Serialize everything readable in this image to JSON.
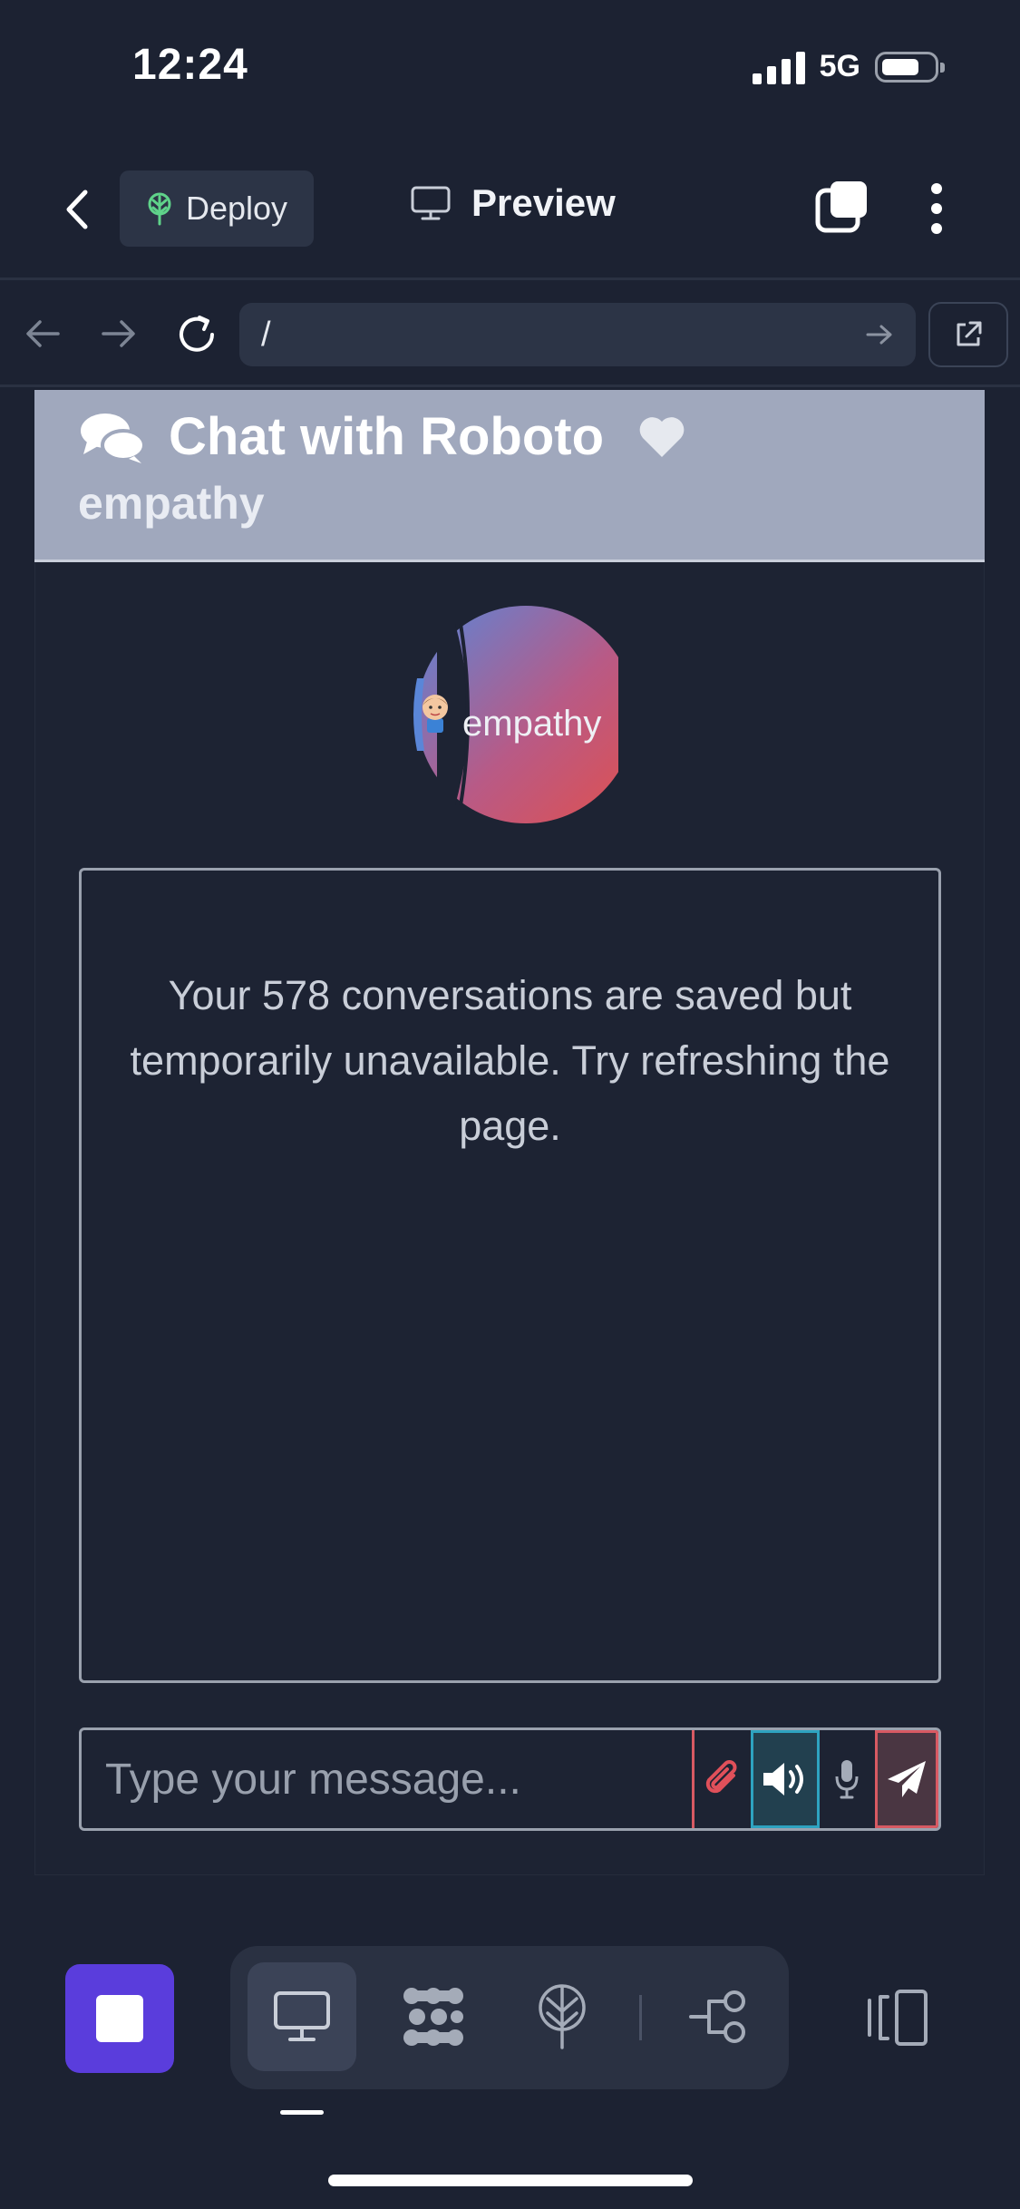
{
  "status": {
    "time": "12:24",
    "network": "5G"
  },
  "toolbar": {
    "deploy_label": "Deploy",
    "preview_label": "Preview"
  },
  "browser": {
    "url": "/"
  },
  "app": {
    "title": "Chat with Roboto",
    "subtitle": "empathy",
    "avatar_label": "empathy",
    "message": "Your 578 conversations are saved but temporarily unavailable. Try refreshing the page.",
    "input_placeholder": "Type your message..."
  },
  "icons": {
    "back": "chevron-left-icon",
    "deploy": "deploy-tree-icon",
    "preview": "monitor-icon",
    "tabs": "tabs-icon",
    "more": "more-vertical-icon",
    "nav_back": "arrow-left-icon",
    "nav_forward": "arrow-right-icon",
    "reload": "reload-icon",
    "go": "go-arrow-icon",
    "open_external": "external-link-icon",
    "chat": "chat-bubbles-icon",
    "favorite": "heart-icon",
    "attach": "paperclip-icon",
    "speaker": "speaker-icon",
    "mic": "microphone-icon",
    "send": "paper-plane-icon",
    "stop": "stop-icon",
    "dock_preview": "monitor-icon",
    "dock_packages": "grid-dots-icon",
    "dock_deploy": "deploy-icon",
    "dock_workflow": "workflow-icon",
    "panel": "side-panel-icon"
  },
  "colors": {
    "background": "#1c2232",
    "header_band": "#a0a8bd",
    "accent_red": "#d85a63",
    "accent_cyan": "#2ea3c0",
    "stop_purple": "#5a3ddc"
  }
}
